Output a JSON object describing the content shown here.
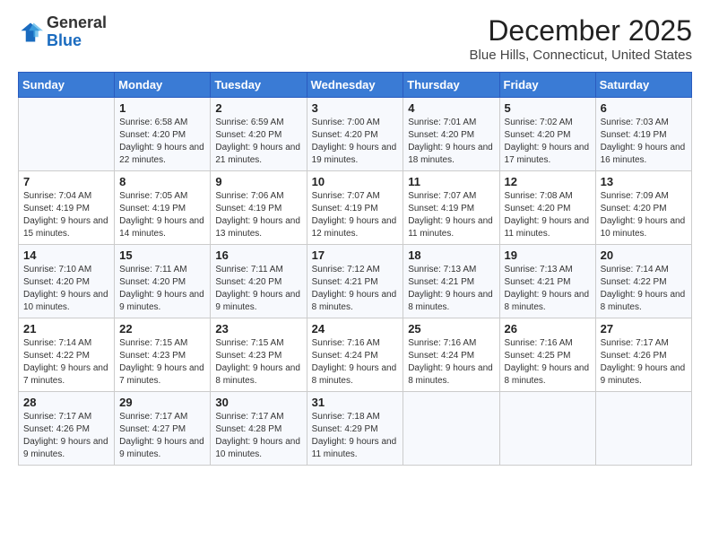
{
  "header": {
    "logo_general": "General",
    "logo_blue": "Blue",
    "month_title": "December 2025",
    "location": "Blue Hills, Connecticut, United States"
  },
  "days_of_week": [
    "Sunday",
    "Monday",
    "Tuesday",
    "Wednesday",
    "Thursday",
    "Friday",
    "Saturday"
  ],
  "weeks": [
    [
      {
        "day": "",
        "sunrise": "",
        "sunset": "",
        "daylight": ""
      },
      {
        "day": "1",
        "sunrise": "Sunrise: 6:58 AM",
        "sunset": "Sunset: 4:20 PM",
        "daylight": "Daylight: 9 hours and 22 minutes."
      },
      {
        "day": "2",
        "sunrise": "Sunrise: 6:59 AM",
        "sunset": "Sunset: 4:20 PM",
        "daylight": "Daylight: 9 hours and 21 minutes."
      },
      {
        "day": "3",
        "sunrise": "Sunrise: 7:00 AM",
        "sunset": "Sunset: 4:20 PM",
        "daylight": "Daylight: 9 hours and 19 minutes."
      },
      {
        "day": "4",
        "sunrise": "Sunrise: 7:01 AM",
        "sunset": "Sunset: 4:20 PM",
        "daylight": "Daylight: 9 hours and 18 minutes."
      },
      {
        "day": "5",
        "sunrise": "Sunrise: 7:02 AM",
        "sunset": "Sunset: 4:20 PM",
        "daylight": "Daylight: 9 hours and 17 minutes."
      },
      {
        "day": "6",
        "sunrise": "Sunrise: 7:03 AM",
        "sunset": "Sunset: 4:19 PM",
        "daylight": "Daylight: 9 hours and 16 minutes."
      }
    ],
    [
      {
        "day": "7",
        "sunrise": "Sunrise: 7:04 AM",
        "sunset": "Sunset: 4:19 PM",
        "daylight": "Daylight: 9 hours and 15 minutes."
      },
      {
        "day": "8",
        "sunrise": "Sunrise: 7:05 AM",
        "sunset": "Sunset: 4:19 PM",
        "daylight": "Daylight: 9 hours and 14 minutes."
      },
      {
        "day": "9",
        "sunrise": "Sunrise: 7:06 AM",
        "sunset": "Sunset: 4:19 PM",
        "daylight": "Daylight: 9 hours and 13 minutes."
      },
      {
        "day": "10",
        "sunrise": "Sunrise: 7:07 AM",
        "sunset": "Sunset: 4:19 PM",
        "daylight": "Daylight: 9 hours and 12 minutes."
      },
      {
        "day": "11",
        "sunrise": "Sunrise: 7:07 AM",
        "sunset": "Sunset: 4:19 PM",
        "daylight": "Daylight: 9 hours and 11 minutes."
      },
      {
        "day": "12",
        "sunrise": "Sunrise: 7:08 AM",
        "sunset": "Sunset: 4:20 PM",
        "daylight": "Daylight: 9 hours and 11 minutes."
      },
      {
        "day": "13",
        "sunrise": "Sunrise: 7:09 AM",
        "sunset": "Sunset: 4:20 PM",
        "daylight": "Daylight: 9 hours and 10 minutes."
      }
    ],
    [
      {
        "day": "14",
        "sunrise": "Sunrise: 7:10 AM",
        "sunset": "Sunset: 4:20 PM",
        "daylight": "Daylight: 9 hours and 10 minutes."
      },
      {
        "day": "15",
        "sunrise": "Sunrise: 7:11 AM",
        "sunset": "Sunset: 4:20 PM",
        "daylight": "Daylight: 9 hours and 9 minutes."
      },
      {
        "day": "16",
        "sunrise": "Sunrise: 7:11 AM",
        "sunset": "Sunset: 4:20 PM",
        "daylight": "Daylight: 9 hours and 9 minutes."
      },
      {
        "day": "17",
        "sunrise": "Sunrise: 7:12 AM",
        "sunset": "Sunset: 4:21 PM",
        "daylight": "Daylight: 9 hours and 8 minutes."
      },
      {
        "day": "18",
        "sunrise": "Sunrise: 7:13 AM",
        "sunset": "Sunset: 4:21 PM",
        "daylight": "Daylight: 9 hours and 8 minutes."
      },
      {
        "day": "19",
        "sunrise": "Sunrise: 7:13 AM",
        "sunset": "Sunset: 4:21 PM",
        "daylight": "Daylight: 9 hours and 8 minutes."
      },
      {
        "day": "20",
        "sunrise": "Sunrise: 7:14 AM",
        "sunset": "Sunset: 4:22 PM",
        "daylight": "Daylight: 9 hours and 8 minutes."
      }
    ],
    [
      {
        "day": "21",
        "sunrise": "Sunrise: 7:14 AM",
        "sunset": "Sunset: 4:22 PM",
        "daylight": "Daylight: 9 hours and 7 minutes."
      },
      {
        "day": "22",
        "sunrise": "Sunrise: 7:15 AM",
        "sunset": "Sunset: 4:23 PM",
        "daylight": "Daylight: 9 hours and 7 minutes."
      },
      {
        "day": "23",
        "sunrise": "Sunrise: 7:15 AM",
        "sunset": "Sunset: 4:23 PM",
        "daylight": "Daylight: 9 hours and 8 minutes."
      },
      {
        "day": "24",
        "sunrise": "Sunrise: 7:16 AM",
        "sunset": "Sunset: 4:24 PM",
        "daylight": "Daylight: 9 hours and 8 minutes."
      },
      {
        "day": "25",
        "sunrise": "Sunrise: 7:16 AM",
        "sunset": "Sunset: 4:24 PM",
        "daylight": "Daylight: 9 hours and 8 minutes."
      },
      {
        "day": "26",
        "sunrise": "Sunrise: 7:16 AM",
        "sunset": "Sunset: 4:25 PM",
        "daylight": "Daylight: 9 hours and 8 minutes."
      },
      {
        "day": "27",
        "sunrise": "Sunrise: 7:17 AM",
        "sunset": "Sunset: 4:26 PM",
        "daylight": "Daylight: 9 hours and 9 minutes."
      }
    ],
    [
      {
        "day": "28",
        "sunrise": "Sunrise: 7:17 AM",
        "sunset": "Sunset: 4:26 PM",
        "daylight": "Daylight: 9 hours and 9 minutes."
      },
      {
        "day": "29",
        "sunrise": "Sunrise: 7:17 AM",
        "sunset": "Sunset: 4:27 PM",
        "daylight": "Daylight: 9 hours and 9 minutes."
      },
      {
        "day": "30",
        "sunrise": "Sunrise: 7:17 AM",
        "sunset": "Sunset: 4:28 PM",
        "daylight": "Daylight: 9 hours and 10 minutes."
      },
      {
        "day": "31",
        "sunrise": "Sunrise: 7:18 AM",
        "sunset": "Sunset: 4:29 PM",
        "daylight": "Daylight: 9 hours and 11 minutes."
      },
      {
        "day": "",
        "sunrise": "",
        "sunset": "",
        "daylight": ""
      },
      {
        "day": "",
        "sunrise": "",
        "sunset": "",
        "daylight": ""
      },
      {
        "day": "",
        "sunrise": "",
        "sunset": "",
        "daylight": ""
      }
    ]
  ]
}
